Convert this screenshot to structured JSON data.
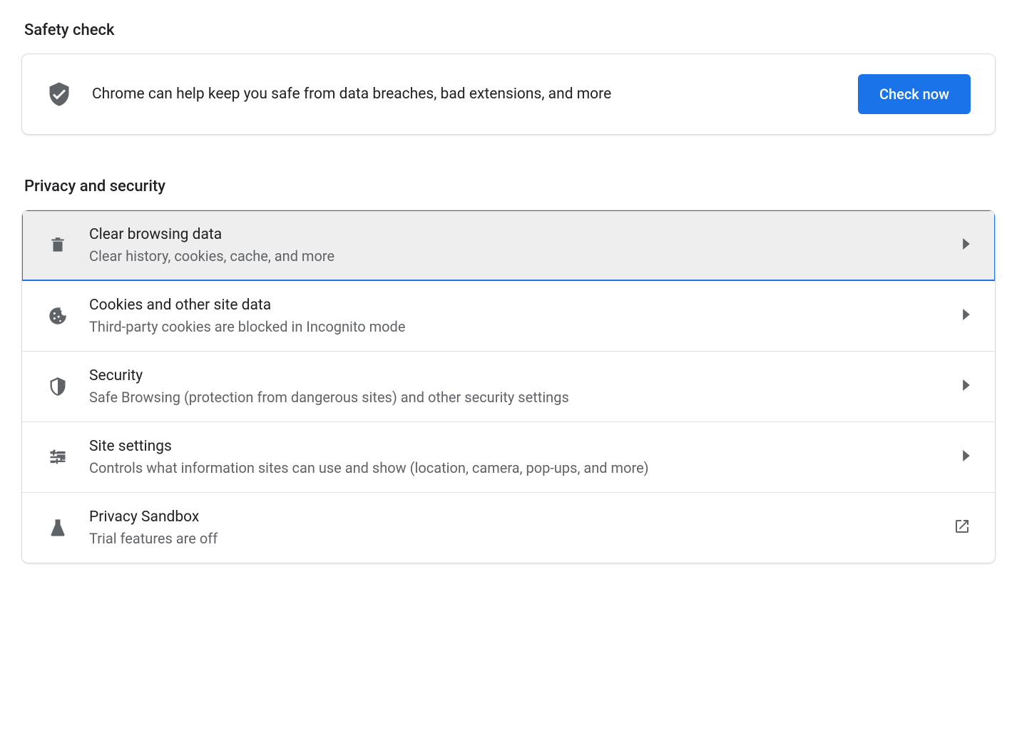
{
  "safety_check": {
    "header": "Safety check",
    "description": "Chrome can help keep you safe from data breaches, bad extensions, and more",
    "button_label": "Check now"
  },
  "privacy_security": {
    "header": "Privacy and security",
    "items": [
      {
        "title": "Clear browsing data",
        "sub": "Clear history, cookies, cache, and more"
      },
      {
        "title": "Cookies and other site data",
        "sub": "Third-party cookies are blocked in Incognito mode"
      },
      {
        "title": "Security",
        "sub": "Safe Browsing (protection from dangerous sites) and other security settings"
      },
      {
        "title": "Site settings",
        "sub": "Controls what information sites can use and show (location, camera, pop-ups, and more)"
      },
      {
        "title": "Privacy Sandbox",
        "sub": "Trial features are off"
      }
    ]
  }
}
